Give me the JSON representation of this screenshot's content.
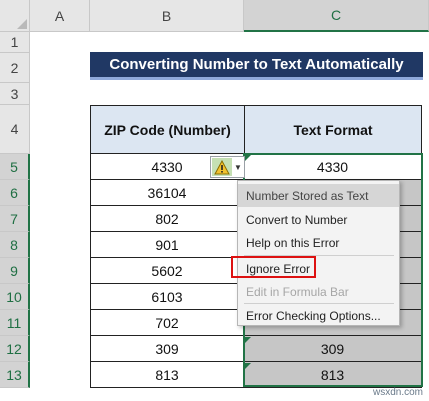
{
  "columns": [
    "A",
    "B",
    "C"
  ],
  "rows": [
    "1",
    "2",
    "3",
    "4",
    "5",
    "6",
    "7",
    "8",
    "9",
    "10",
    "11",
    "12",
    "13"
  ],
  "title": "Converting Number to Text Automatically",
  "table": {
    "headers": [
      "ZIP Code (Number)",
      "Text Format"
    ],
    "zip_numbers": [
      "4330",
      "36104",
      "802",
      "901",
      "5602",
      "6103",
      "702",
      "309",
      "813"
    ],
    "text_format": [
      "4330",
      "",
      "",
      "",
      "",
      "",
      "",
      "309",
      "813"
    ]
  },
  "error_menu": {
    "items": [
      "Number Stored as Text",
      "Convert to Number",
      "Help on this Error",
      "Ignore Error",
      "Edit in Formula Bar",
      "Error Checking Options..."
    ]
  },
  "colors": {
    "title_bg": "#203864",
    "header_bg": "#dce6f2",
    "selection": "#217346",
    "highlight_box": "#dd1111"
  },
  "icons": {
    "warning": "warning-triangle-icon",
    "dropdown": "chevron-down-icon"
  },
  "watermark": "wsxdn.com"
}
